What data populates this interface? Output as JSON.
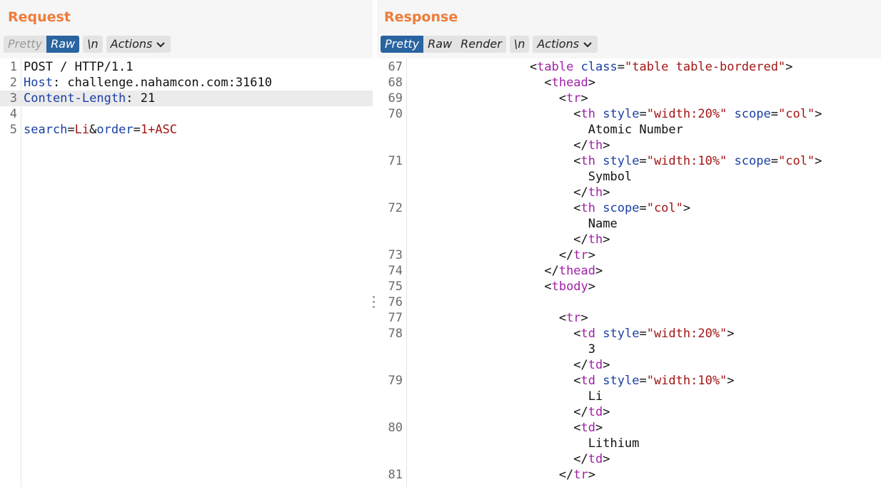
{
  "request": {
    "title": "Request",
    "toolbar": {
      "pretty": "Pretty",
      "raw": "Raw",
      "newline": "\\n",
      "actions": "Actions"
    },
    "lines": [
      {
        "n": "1",
        "parts": [
          [
            "plain",
            "POST / HTTP/1.1"
          ]
        ]
      },
      {
        "n": "2",
        "parts": [
          [
            "key",
            "Host"
          ],
          [
            "plain",
            ": challenge.nahamcon.com:31610"
          ]
        ]
      },
      {
        "n": "3",
        "parts": [
          [
            "key",
            "Content-Length"
          ],
          [
            "plain",
            ": 21"
          ]
        ],
        "highlight": true
      },
      {
        "n": "4",
        "parts": []
      },
      {
        "n": "5",
        "parts": [
          [
            "key",
            "search"
          ],
          [
            "plain",
            "="
          ],
          [
            "val",
            "Li"
          ],
          [
            "plain",
            "&"
          ],
          [
            "key",
            "order"
          ],
          [
            "plain",
            "="
          ],
          [
            "val",
            "1+ASC"
          ]
        ]
      }
    ]
  },
  "response": {
    "title": "Response",
    "toolbar": {
      "pretty": "Pretty",
      "raw": "Raw",
      "render": "Render",
      "newline": "\\n",
      "actions": "Actions"
    },
    "lines": [
      {
        "n": "67",
        "parts": [
          [
            "plain",
            "        <"
          ],
          [
            "tag",
            "table"
          ],
          [
            "plain",
            " "
          ],
          [
            "attr",
            "class"
          ],
          [
            "plain",
            "="
          ],
          [
            "val",
            "\"table table-bordered\""
          ],
          [
            "plain",
            ">"
          ]
        ]
      },
      {
        "n": "68",
        "parts": [
          [
            "plain",
            "          <"
          ],
          [
            "tag",
            "thead"
          ],
          [
            "plain",
            ">"
          ]
        ]
      },
      {
        "n": "69",
        "parts": [
          [
            "plain",
            "            <"
          ],
          [
            "tag",
            "tr"
          ],
          [
            "plain",
            ">"
          ]
        ]
      },
      {
        "n": "70",
        "parts": [
          [
            "plain",
            "              <"
          ],
          [
            "tag",
            "th"
          ],
          [
            "plain",
            " "
          ],
          [
            "attr",
            "style"
          ],
          [
            "plain",
            "="
          ],
          [
            "val",
            "\"width:20%\""
          ],
          [
            "plain",
            " "
          ],
          [
            "attr",
            "scope"
          ],
          [
            "plain",
            "="
          ],
          [
            "val",
            "\"col\""
          ],
          [
            "plain",
            ">"
          ]
        ]
      },
      {
        "n": "",
        "parts": [
          [
            "plain",
            "                Atomic Number"
          ]
        ]
      },
      {
        "n": "",
        "parts": [
          [
            "plain",
            "              </"
          ],
          [
            "tag",
            "th"
          ],
          [
            "plain",
            ">"
          ]
        ]
      },
      {
        "n": "71",
        "parts": [
          [
            "plain",
            "              <"
          ],
          [
            "tag",
            "th"
          ],
          [
            "plain",
            " "
          ],
          [
            "attr",
            "style"
          ],
          [
            "plain",
            "="
          ],
          [
            "val",
            "\"width:10%\""
          ],
          [
            "plain",
            " "
          ],
          [
            "attr",
            "scope"
          ],
          [
            "plain",
            "="
          ],
          [
            "val",
            "\"col\""
          ],
          [
            "plain",
            ">"
          ]
        ]
      },
      {
        "n": "",
        "parts": [
          [
            "plain",
            "                Symbol"
          ]
        ]
      },
      {
        "n": "",
        "parts": [
          [
            "plain",
            "              </"
          ],
          [
            "tag",
            "th"
          ],
          [
            "plain",
            ">"
          ]
        ]
      },
      {
        "n": "72",
        "parts": [
          [
            "plain",
            "              <"
          ],
          [
            "tag",
            "th"
          ],
          [
            "plain",
            " "
          ],
          [
            "attr",
            "scope"
          ],
          [
            "plain",
            "="
          ],
          [
            "val",
            "\"col\""
          ],
          [
            "plain",
            ">"
          ]
        ]
      },
      {
        "n": "",
        "parts": [
          [
            "plain",
            "                Name"
          ]
        ]
      },
      {
        "n": "",
        "parts": [
          [
            "plain",
            "              </"
          ],
          [
            "tag",
            "th"
          ],
          [
            "plain",
            ">"
          ]
        ]
      },
      {
        "n": "73",
        "parts": [
          [
            "plain",
            "            </"
          ],
          [
            "tag",
            "tr"
          ],
          [
            "plain",
            ">"
          ]
        ]
      },
      {
        "n": "74",
        "parts": [
          [
            "plain",
            "          </"
          ],
          [
            "tag",
            "thead"
          ],
          [
            "plain",
            ">"
          ]
        ]
      },
      {
        "n": "75",
        "parts": [
          [
            "plain",
            "          <"
          ],
          [
            "tag",
            "tbody"
          ],
          [
            "plain",
            ">"
          ]
        ]
      },
      {
        "n": "76",
        "parts": []
      },
      {
        "n": "77",
        "parts": [
          [
            "plain",
            "            <"
          ],
          [
            "tag",
            "tr"
          ],
          [
            "plain",
            ">"
          ]
        ]
      },
      {
        "n": "78",
        "parts": [
          [
            "plain",
            "              <"
          ],
          [
            "tag",
            "td"
          ],
          [
            "plain",
            " "
          ],
          [
            "attr",
            "style"
          ],
          [
            "plain",
            "="
          ],
          [
            "val",
            "\"width:20%\""
          ],
          [
            "plain",
            ">"
          ]
        ]
      },
      {
        "n": "",
        "parts": [
          [
            "plain",
            "                3"
          ]
        ]
      },
      {
        "n": "",
        "parts": [
          [
            "plain",
            "              </"
          ],
          [
            "tag",
            "td"
          ],
          [
            "plain",
            ">"
          ]
        ]
      },
      {
        "n": "79",
        "parts": [
          [
            "plain",
            "              <"
          ],
          [
            "tag",
            "td"
          ],
          [
            "plain",
            " "
          ],
          [
            "attr",
            "style"
          ],
          [
            "plain",
            "="
          ],
          [
            "val",
            "\"width:10%\""
          ],
          [
            "plain",
            ">"
          ]
        ]
      },
      {
        "n": "",
        "parts": [
          [
            "plain",
            "                Li"
          ]
        ]
      },
      {
        "n": "",
        "parts": [
          [
            "plain",
            "              </"
          ],
          [
            "tag",
            "td"
          ],
          [
            "plain",
            ">"
          ]
        ]
      },
      {
        "n": "80",
        "parts": [
          [
            "plain",
            "              <"
          ],
          [
            "tag",
            "td"
          ],
          [
            "plain",
            ">"
          ]
        ]
      },
      {
        "n": "",
        "parts": [
          [
            "plain",
            "                Lithium"
          ]
        ]
      },
      {
        "n": "",
        "parts": [
          [
            "plain",
            "              </"
          ],
          [
            "tag",
            "td"
          ],
          [
            "plain",
            ">"
          ]
        ]
      },
      {
        "n": "81",
        "parts": [
          [
            "plain",
            "            </"
          ],
          [
            "tag",
            "tr"
          ],
          [
            "plain",
            ">"
          ]
        ]
      }
    ]
  },
  "colors": {
    "title": "#ee7c3a",
    "active_tab": "#2a64a0",
    "tag": "#a020a8",
    "attribute": "#1a3fa5",
    "value": "#a31515"
  },
  "icons": {
    "actions_dropdown": "chevron-down-icon",
    "pane_divider": "drag-handle-icon"
  }
}
